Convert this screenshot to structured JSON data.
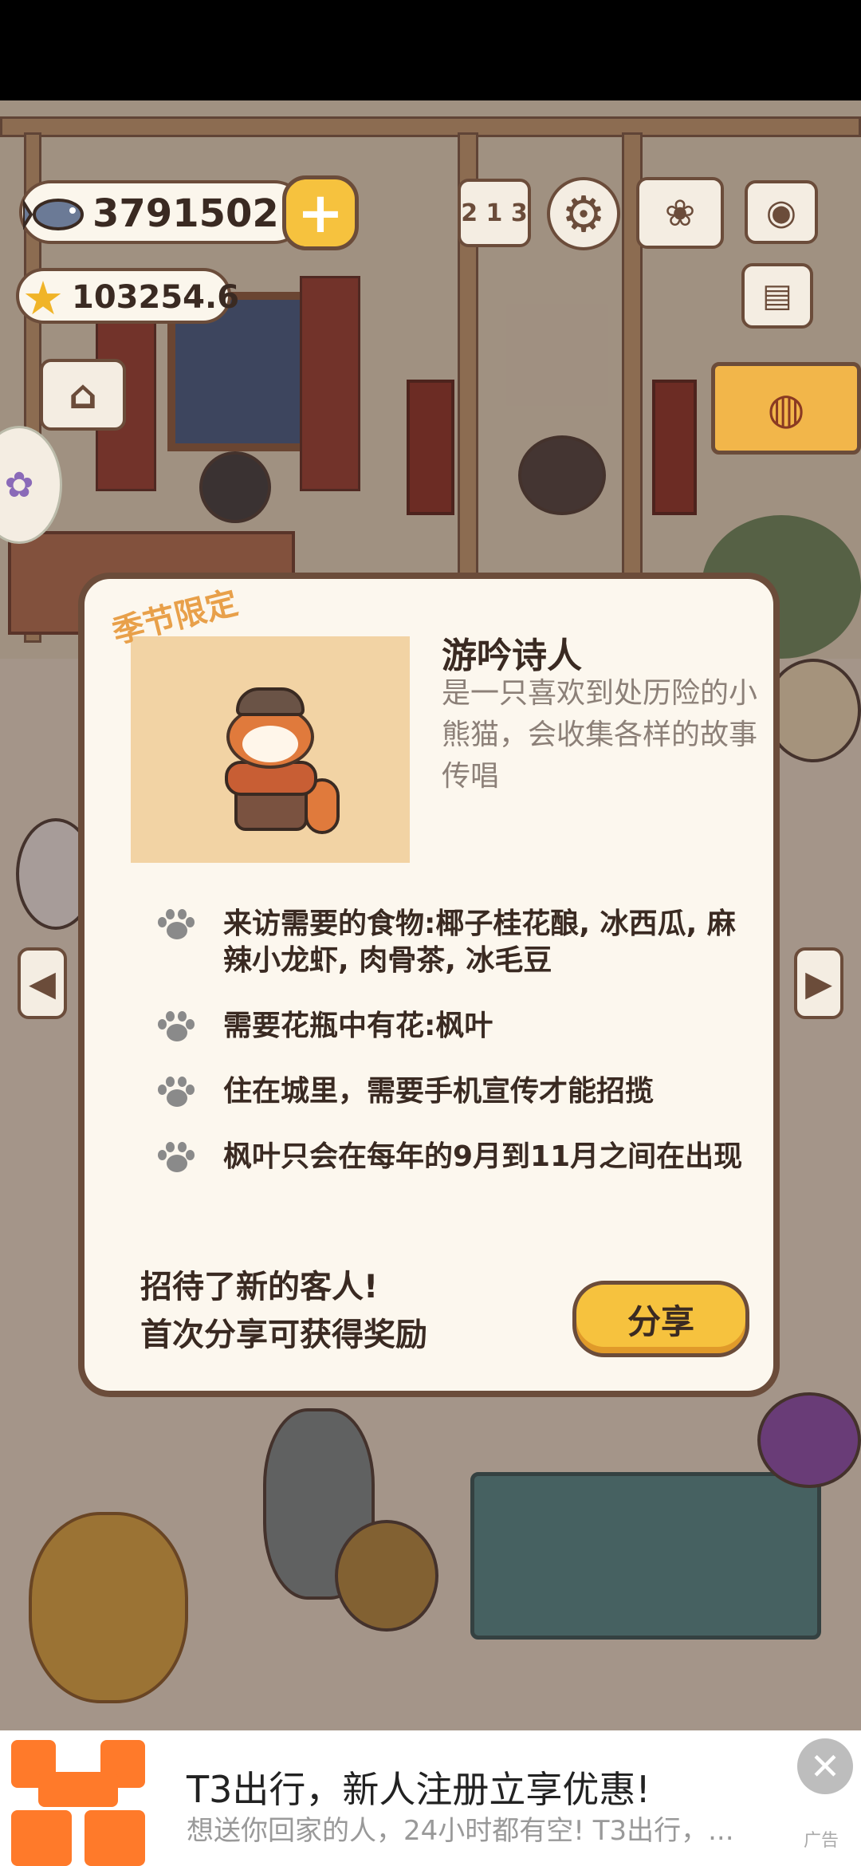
{
  "hud": {
    "fish_count": "3791502",
    "plus_label": "+",
    "star_count": "103254.6",
    "rank_label": "2 1 3"
  },
  "icons": {
    "fish": "fish-icon",
    "star": "star-icon",
    "rank": "podium-icon",
    "settings": "gear-icon",
    "guestbook": "book-icon",
    "camera": "camera-icon",
    "news": "newspaper-icon",
    "shop": "shop-icon",
    "event": "lantern-icon",
    "paw": "paw-icon"
  },
  "dialog": {
    "season_tag": "季节限定",
    "character_name": "游吟诗人",
    "character_description": "是一只喜欢到处历险的小熊猫，会收集各样的故事传唱",
    "requirements": [
      "来访需要的食物:椰子桂花酿, 冰西瓜, 麻辣小龙虾, 肉骨茶, 冰毛豆",
      "需要花瓶中有花:枫叶",
      "住在城里，需要手机宣传才能招揽",
      "枫叶只会在每年的9月到11月之间在出现"
    ],
    "share_note_line1": "招待了新的客人!",
    "share_note_line2": "首次分享可获得奖励",
    "share_button": "分享"
  },
  "ad": {
    "title": "T3出行，新人注册立享优惠!",
    "subtitle": "想送你回家的人，24小时都有空! T3出行，...",
    "tag": "广告",
    "close": "✕"
  },
  "colors": {
    "accent_yellow": "#f6c23e",
    "outline_brown": "#6b4c3a",
    "dialog_bg": "#fcf7ee",
    "season_orange": "#e8a04a",
    "ad_orange": "#ff7a2a"
  }
}
